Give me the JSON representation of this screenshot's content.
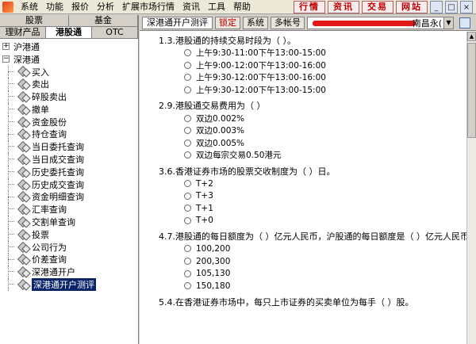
{
  "menu": {
    "items": [
      "系统",
      "功能",
      "报价",
      "分析",
      "扩展市场行情",
      "资讯",
      "工具",
      "帮助"
    ],
    "right_buttons": [
      "行情",
      "资讯",
      "交易",
      "网站"
    ],
    "window_controls": [
      "minimize-icon",
      "restore-icon",
      "close-icon"
    ]
  },
  "left_tabs_row1": [
    "股票",
    "基金"
  ],
  "left_tabs_row2": [
    "理财产品",
    "港股通",
    "OTC"
  ],
  "tree": {
    "hgt": "沪港通",
    "sgt": "深港通",
    "items": [
      "买入",
      "卖出",
      "碎股卖出",
      "撤单",
      "资金股份",
      "持仓查询",
      "当日委托查询",
      "当日成交查询",
      "历史委托查询",
      "历史成交查询",
      "资金明细查询",
      "汇率查询",
      "交割单查询",
      "投票",
      "公司行为",
      "价差查询",
      "深港通开户",
      "深港通开户测评"
    ]
  },
  "toolbar": {
    "title": "深港通开户测评",
    "lock": "锁定",
    "system": "系统",
    "multi_account": "多帐号",
    "account_tail": "南昌永("
  },
  "questions": [
    {
      "num": "1.3.",
      "text": "港股通的持续交易时段为（ ）。",
      "options": [
        "上午9:30-11:00下午13:00-15:00",
        "上午9:00-12:00下午13:00-16:00",
        "上午9:30-12:00下午13:00-16:00",
        "上午9:30-12:00下午13:00-15:00"
      ]
    },
    {
      "num": "2.9.",
      "text": "港股通交易费用为（ ）",
      "options": [
        "双边0.002%",
        "双边0.003%",
        "双边0.005%",
        "双边每宗交易0.50港元"
      ]
    },
    {
      "num": "3.6.",
      "text": "香港证券市场的股票交收制度为（ ）日。",
      "options": [
        "T+2",
        "T+3",
        "T+1",
        "T+0"
      ]
    },
    {
      "num": "4.7.",
      "text": "港股通的每日额度为（ ）亿元人民币，沪股通的每日额度是（ ）亿元人民币。",
      "options": [
        "100,200",
        "200,300",
        "105,130",
        "150,180"
      ]
    },
    {
      "num": "5.4.",
      "text": "在香港证券市场中，每只上市证券的买卖单位为每手（ ）股。",
      "options": []
    }
  ],
  "colors": {
    "selection": "#0a246a",
    "accent_red": "#c00000",
    "mask_red": "#e01818"
  }
}
